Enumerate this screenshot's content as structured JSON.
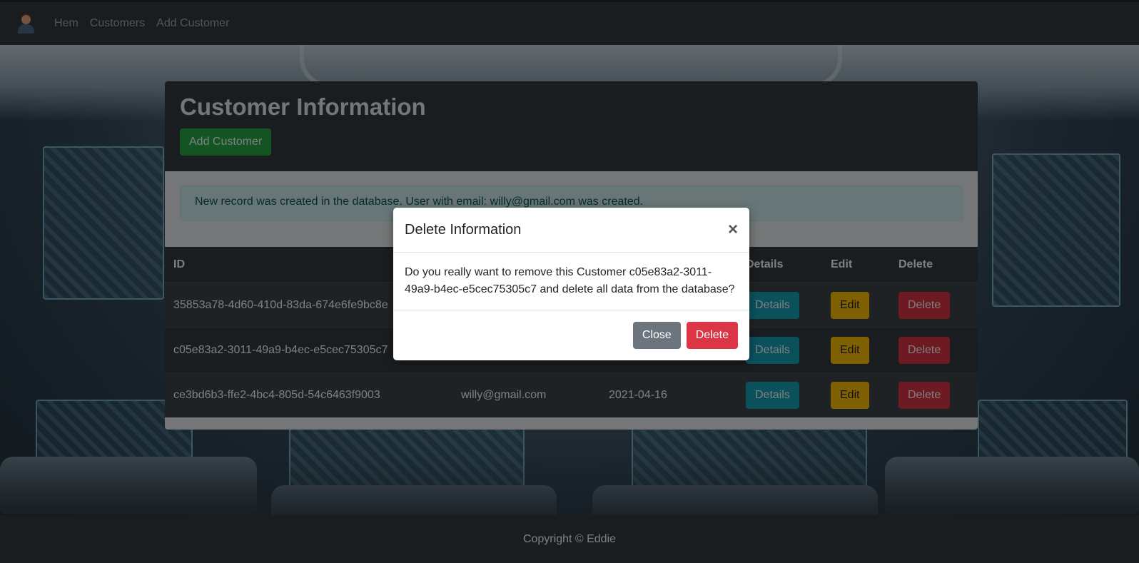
{
  "navbar": {
    "links": [
      "Hem",
      "Customers",
      "Add Customer"
    ]
  },
  "card": {
    "title": "Customer Information",
    "add_button_label": "Add Customer",
    "alert_text": "New record was created in the database. User with email: willy@gmail.com was created."
  },
  "table": {
    "headers": [
      "ID",
      "",
      "",
      "Details",
      "Edit",
      "Delete"
    ],
    "rows": [
      {
        "id": "35853a78-4d60-410d-83da-674e6fe9bc8e",
        "email": "",
        "date": ""
      },
      {
        "id": "c05e83a2-3011-49a9-b4ec-e5cec75305c7",
        "email": "",
        "date": ""
      },
      {
        "id": "ce3bd6b3-ffe2-4bc4-805d-54c6463f9003",
        "email": "willy@gmail.com",
        "date": "2021-04-16"
      }
    ],
    "details_label": "Details",
    "edit_label": "Edit",
    "delete_label": "Delete"
  },
  "modal": {
    "title": "Delete Information",
    "close_symbol": "×",
    "body_text": "Do you really want to remove this Customer c05e83a2-3011-49a9-b4ec-e5cec75305c7 and delete all data from the database?",
    "close_button_label": "Close",
    "delete_button_label": "Delete"
  },
  "footer": {
    "text": "Copyright © Eddie"
  },
  "colors": {
    "navbar": "#343a40",
    "success": "#28a745",
    "info": "#17a2b8",
    "warning": "#ffc107",
    "danger": "#dc3545",
    "secondary": "#6c757d"
  }
}
